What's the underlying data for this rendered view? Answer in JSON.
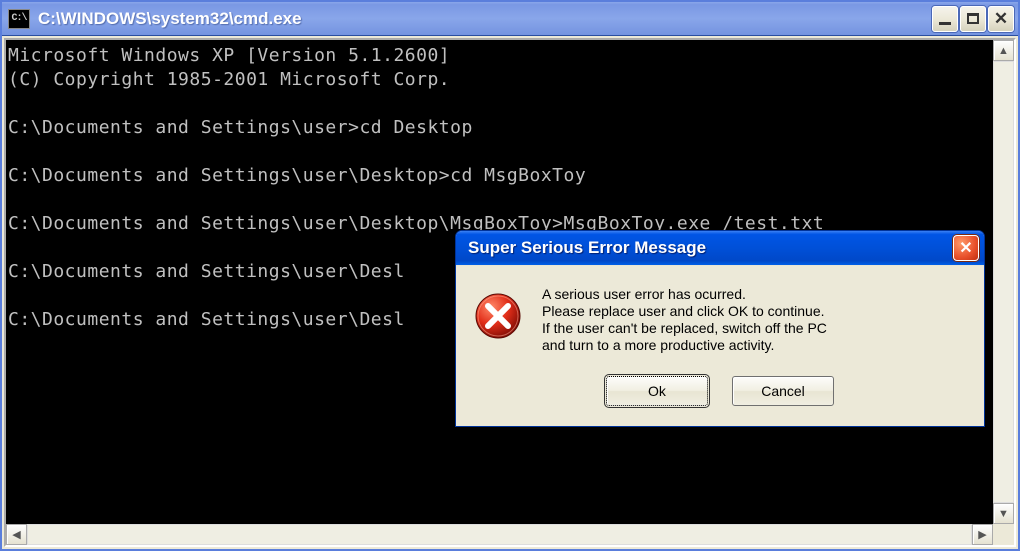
{
  "cmd": {
    "icon_text": "C:\\",
    "title": "C:\\WINDOWS\\system32\\cmd.exe",
    "lines": [
      "Microsoft Windows XP [Version 5.1.2600]",
      "(C) Copyright 1985-2001 Microsoft Corp.",
      "",
      "C:\\Documents and Settings\\user>cd Desktop",
      "",
      "C:\\Documents and Settings\\user\\Desktop>cd MsgBoxToy",
      "",
      "C:\\Documents and Settings\\user\\Desktop\\MsgBoxToy>MsgBoxToy.exe /test.txt",
      "",
      "C:\\Documents and Settings\\user\\Desl",
      "",
      "C:\\Documents and Settings\\user\\Desl"
    ]
  },
  "dialog": {
    "title": "Super Serious Error Message",
    "lines": [
      "A serious user error has ocurred.",
      "Please replace user and click OK to continue.",
      "If the user can't be replaced, switch off the PC",
      "and turn to a more productive activity."
    ],
    "ok_label": "Ok",
    "cancel_label": "Cancel"
  }
}
